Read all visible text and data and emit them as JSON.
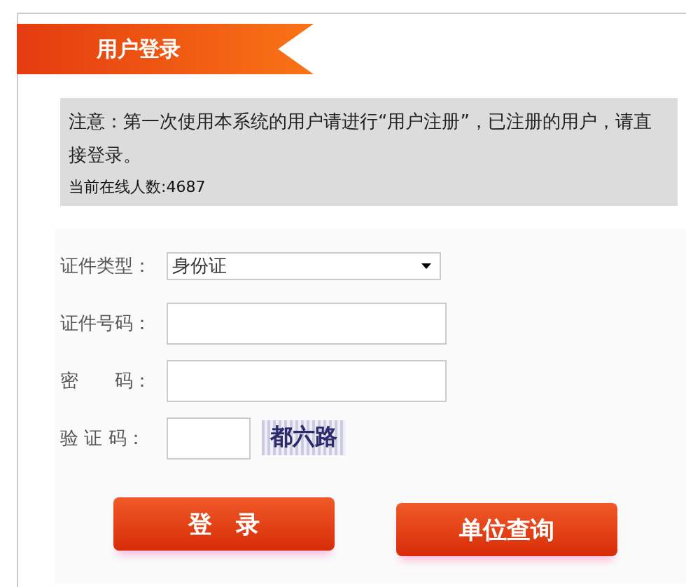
{
  "header": {
    "title": "用户登录"
  },
  "notice": {
    "text": "注意：第一次使用本系统的用户请进行“用户注册”，已注册的用户，请直接登录。",
    "online": "当前在线人数:4687"
  },
  "form": [
    {
      "kind": "select",
      "label": "证件类型：",
      "value": "身份证"
    },
    {
      "kind": "input",
      "label": "证件号码："
    },
    {
      "kind": "input",
      "label": "密　　码："
    },
    {
      "kind": "captcha",
      "label": "验 证 码：",
      "captcha": "都六路"
    }
  ],
  "buttons": [
    "登　录",
    "单位查询"
  ]
}
